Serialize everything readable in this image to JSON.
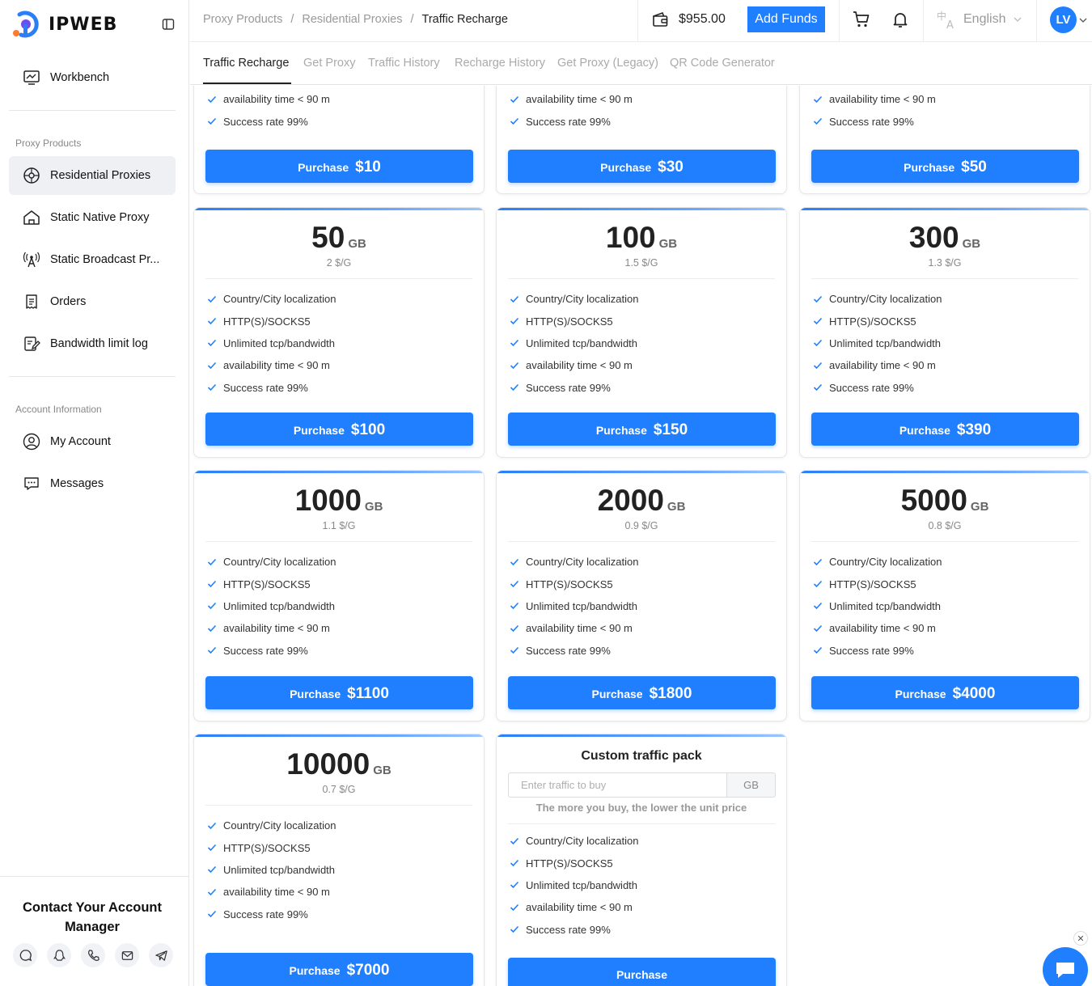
{
  "brand": {
    "name": "IPWEB"
  },
  "sidebar": {
    "workbench": "Workbench",
    "proxy_section": "Proxy Products",
    "proxy_items": [
      "Residential Proxies",
      "Static Native Proxy",
      "Static Broadcast Pr...",
      "Orders",
      "Bandwidth limit log"
    ],
    "account_section": "Account Information",
    "account_items": [
      "My Account",
      "Messages"
    ],
    "contact_title": "Contact Your Account Manager"
  },
  "header": {
    "breadcrumb": [
      "Proxy Products",
      "Residential Proxies",
      "Traffic Recharge"
    ],
    "balance": "$955.00",
    "add_funds": "Add Funds",
    "language": "English",
    "avatar": "LV"
  },
  "tabs": [
    "Traffic Recharge",
    "Get Proxy",
    "Traffic History",
    "Recharge History",
    "Get Proxy (Legacy)",
    "QR Code Generator"
  ],
  "features": [
    "Country/City localization",
    "HTTP(S)/SOCKS5",
    "Unlimited tcp/bandwidth",
    "availability time < 90 m",
    "Success rate 99%"
  ],
  "partial_features": [
    "availability time < 90 m",
    "Success rate 99%"
  ],
  "purchase_label": "Purchase",
  "unit": "GB",
  "partial_packages": [
    {
      "amount": "$10"
    },
    {
      "amount": "$30"
    },
    {
      "amount": "$50"
    }
  ],
  "packages": [
    {
      "size": "50",
      "price": "2 $/G",
      "amount": "$100"
    },
    {
      "size": "100",
      "price": "1.5 $/G",
      "amount": "$150"
    },
    {
      "size": "300",
      "price": "1.3 $/G",
      "amount": "$390"
    },
    {
      "size": "1000",
      "price": "1.1 $/G",
      "amount": "$1100"
    },
    {
      "size": "2000",
      "price": "0.9 $/G",
      "amount": "$1800"
    },
    {
      "size": "5000",
      "price": "0.8 $/G",
      "amount": "$4000"
    },
    {
      "size": "10000",
      "price": "0.7 $/G",
      "amount": "$7000"
    }
  ],
  "custom": {
    "title": "Custom traffic pack",
    "placeholder": "Enter traffic to buy",
    "unit": "GB",
    "hint": "The more you buy, the lower the unit price",
    "button": "Purchase"
  },
  "colors": {
    "accent": "#1f7fff",
    "check": "#1f7fff"
  }
}
